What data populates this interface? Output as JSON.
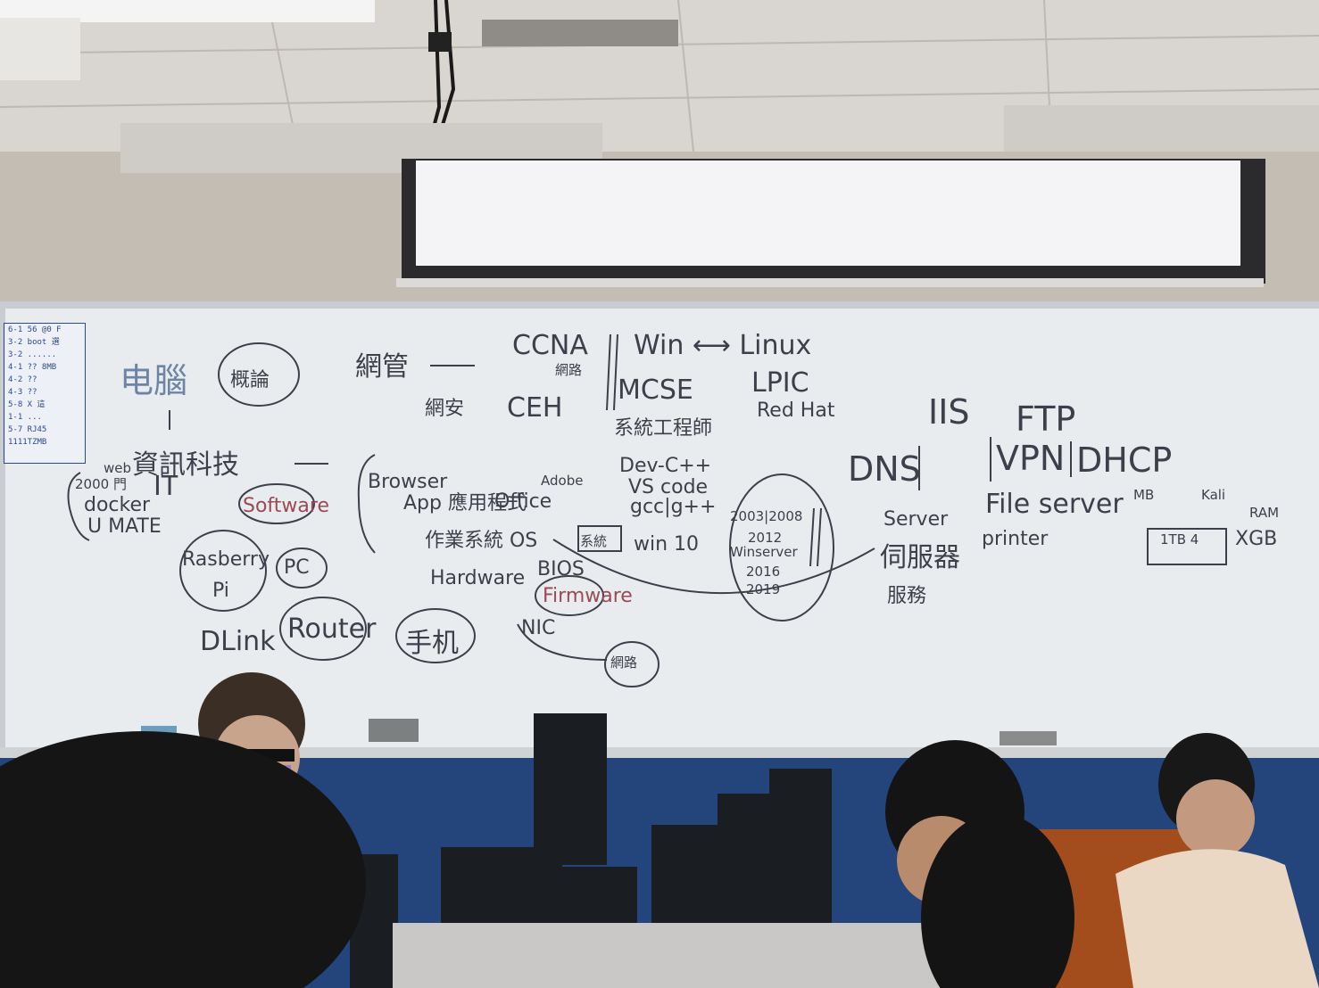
{
  "whiteboard": {
    "legend": [
      "6-1  56 @0 F",
      "3-2  boot 選 ",
      "3-2  ......",
      "4-1  ?? 8MB",
      "4-2  ??",
      "4-3  ??",
      "5-8 X  這 ",
      "1-1 ...",
      "5-7 RJ45",
      "1111TZMB"
    ],
    "left": {
      "computer": "电腦",
      "overview": "概論",
      "it_chinese": "資訊科技",
      "it": "IT",
      "web": "web",
      "year": "2000 門",
      "docker": "docker",
      "umate": "U MATE",
      "software": "Software",
      "raspberry": "Rasberry",
      "pi": "Pi",
      "pc": "PC",
      "dlink": "DLink",
      "router": "Router",
      "phone": "手机"
    },
    "middle": {
      "browser": "Browser",
      "app": "App 應用程式",
      "office": "Office",
      "adobe": "Adobe",
      "os": "作業系統 OS",
      "hardware": "Hardware",
      "bios": "BIOS",
      "firmware": "Firmware",
      "nic": "NIC",
      "network": "網路",
      "system_small": "系統",
      "win10": "win 10"
    },
    "top": {
      "netmgmt": "網管",
      "netsec": "網安",
      "ccna": "CCNA",
      "ccna_sub": "網路",
      "ceh": "CEH",
      "win_linux": "Win ⟷ Linux",
      "mcse": "MCSE",
      "lpic": "LPIC",
      "sysengineer": "系統工程師",
      "redhat": "Red Hat"
    },
    "dev": {
      "devcpp": "Dev-C++",
      "vscode": "VS code",
      "gcc": "gcc|g++"
    },
    "winserver": {
      "v1": "2003|2008",
      "v2": "2012",
      "label": "Winserver",
      "v3": "2016",
      "v4": "2019"
    },
    "right": {
      "iis": "IIS",
      "ftp": "FTP",
      "dns": "DNS",
      "vpn": "VPN",
      "dhcp": "DHCP",
      "server": "Server",
      "server_cn": "伺服器",
      "service": "服務",
      "fileserver": "File server",
      "printer": "printer",
      "mb": "MB",
      "kali": "Kali",
      "ram": "RAM",
      "xgb": "XGB",
      "disk": "1TB 4"
    }
  }
}
